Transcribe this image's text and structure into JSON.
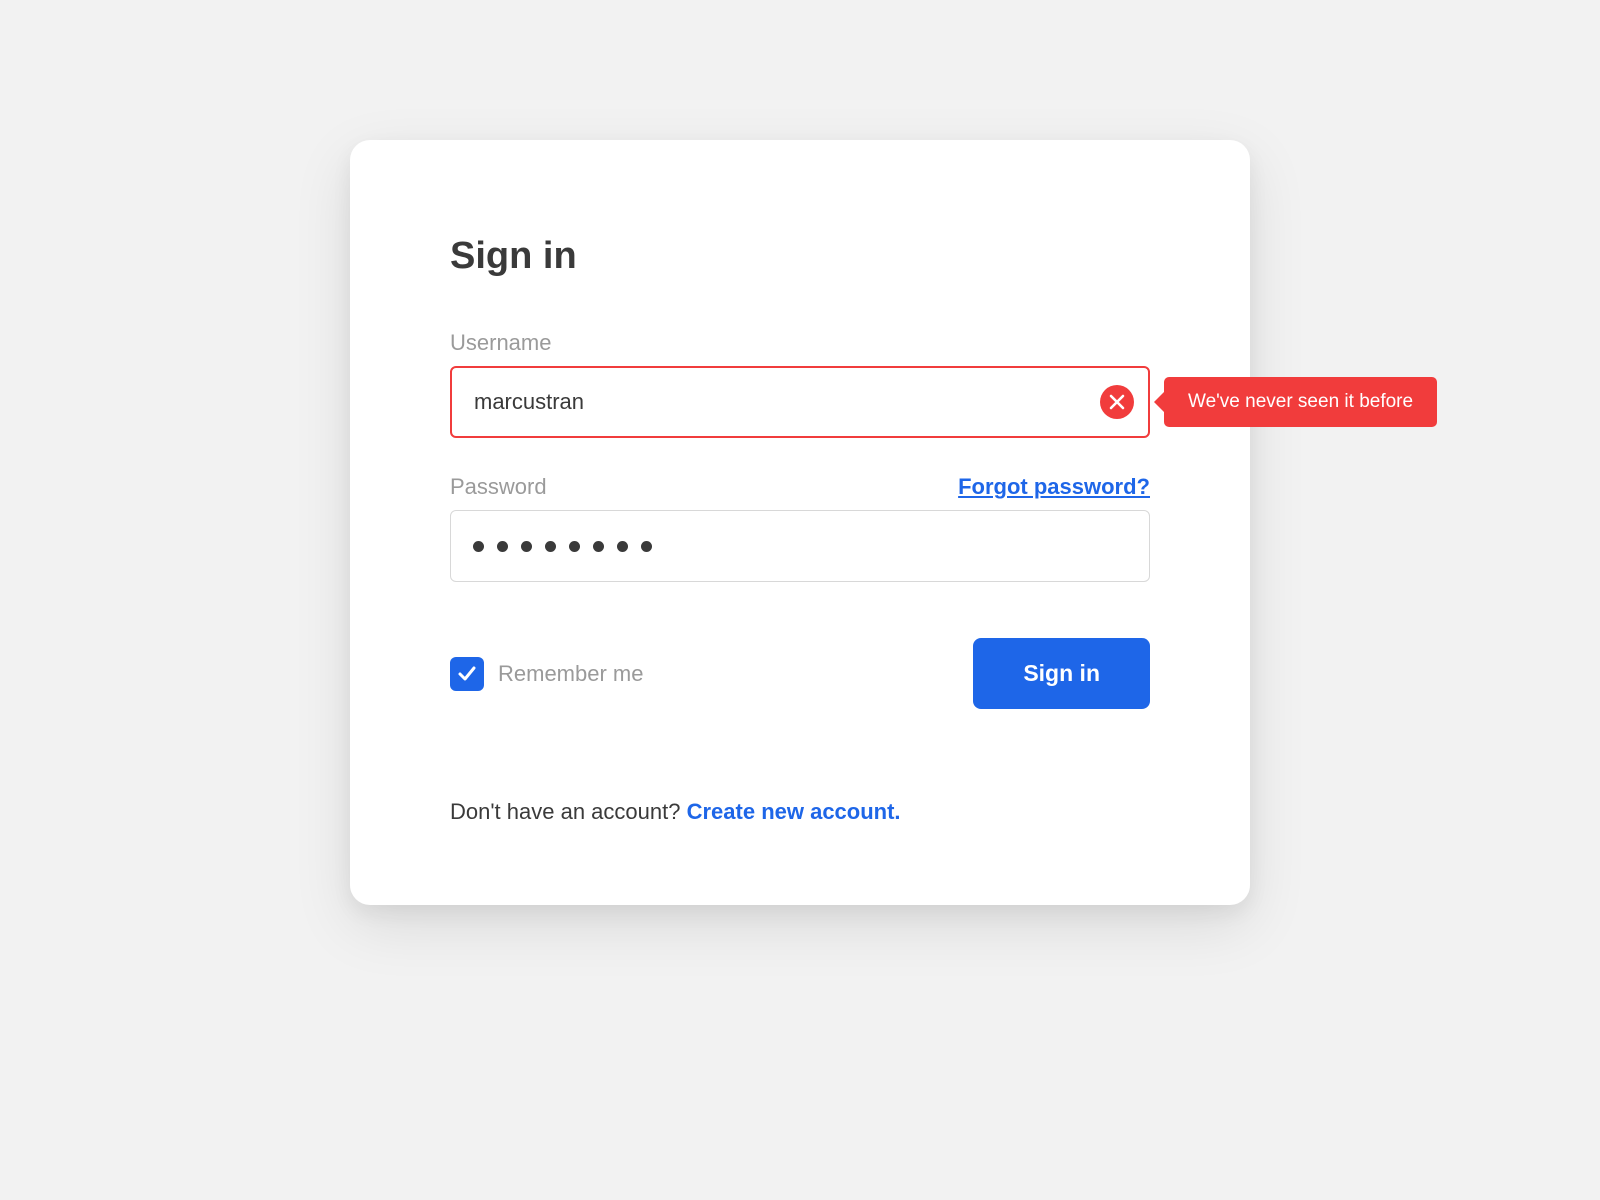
{
  "title": "Sign in",
  "username": {
    "label": "Username",
    "value": "marcustran",
    "error_message": "We've never seen it before"
  },
  "password": {
    "label": "Password",
    "forgot_link": "Forgot password?",
    "masked_length": 8
  },
  "remember": {
    "label": "Remember me",
    "checked": true
  },
  "submit_label": "Sign in",
  "footer": {
    "prompt": "Don't have an account? ",
    "link_text": "Create new account."
  },
  "colors": {
    "primary": "#1e66e8",
    "error": "#f13c3c"
  }
}
